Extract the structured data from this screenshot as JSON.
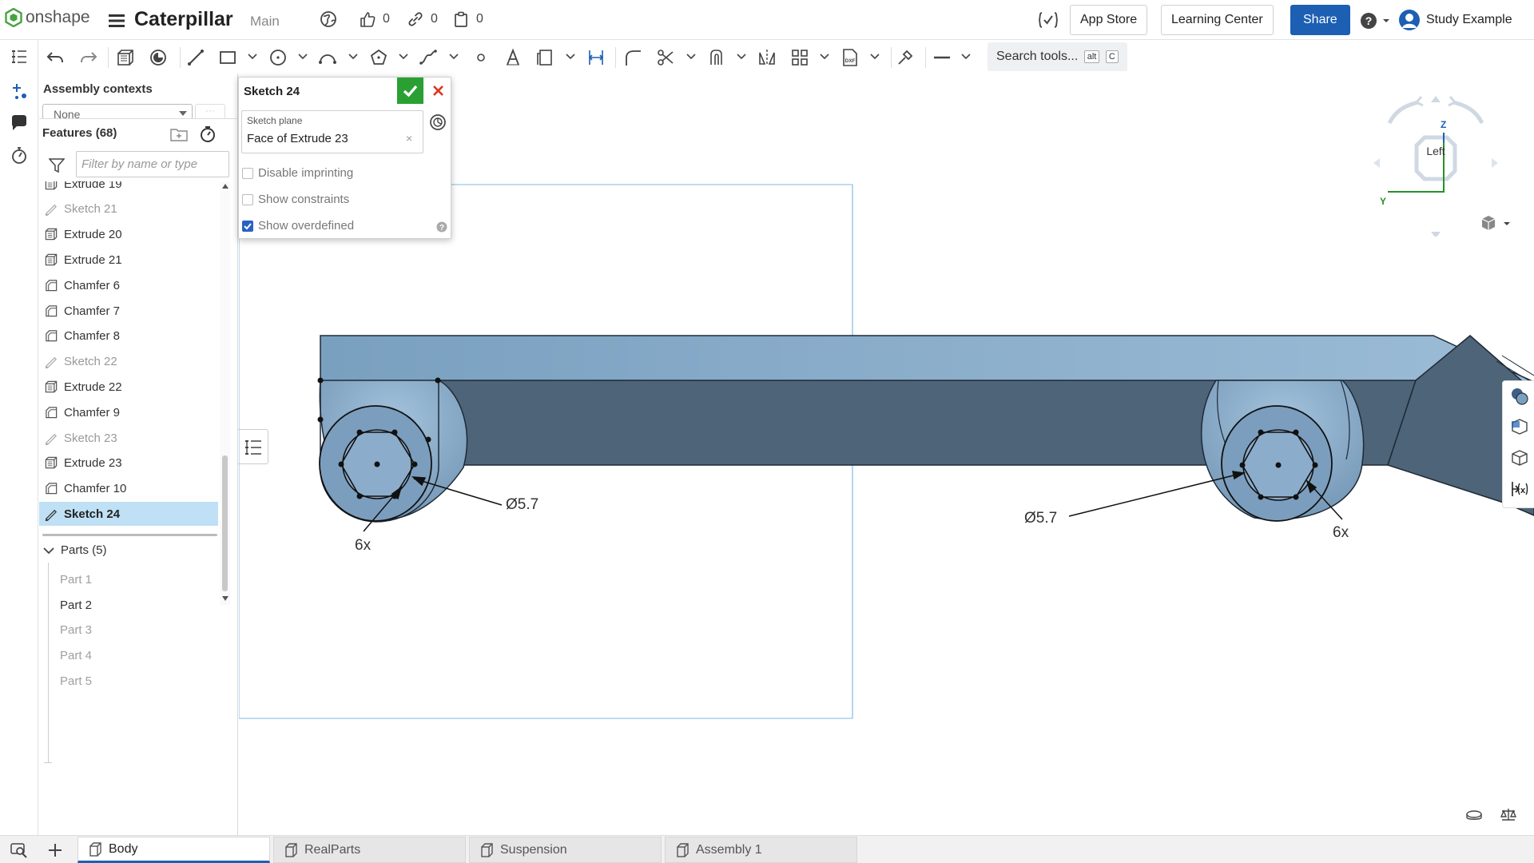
{
  "brand": {
    "name": "onshape"
  },
  "document": {
    "title": "Caterpillar",
    "branch": "Main"
  },
  "header": {
    "likes": "0",
    "links": "0",
    "copies": "0",
    "app_store": "App Store",
    "learning_center": "Learning Center",
    "share": "Share",
    "user": "Study Example"
  },
  "toolbar": {
    "search": "Search tools...",
    "shortcut_alt": "alt",
    "shortcut_key": "C"
  },
  "panel": {
    "assembly_contexts": "Assembly contexts",
    "assembly_context_value": "None",
    "features_title": "Features (68)",
    "filter_placeholder": "Filter by name or type",
    "features": [
      {
        "label": "Extrude 19",
        "type": "extrude"
      },
      {
        "label": "Sketch 21",
        "type": "sketch"
      },
      {
        "label": "Extrude 20",
        "type": "extrude"
      },
      {
        "label": "Extrude 21",
        "type": "extrude"
      },
      {
        "label": "Chamfer 6",
        "type": "chamfer"
      },
      {
        "label": "Chamfer 7",
        "type": "chamfer"
      },
      {
        "label": "Chamfer 8",
        "type": "chamfer"
      },
      {
        "label": "Sketch 22",
        "type": "sketch"
      },
      {
        "label": "Extrude 22",
        "type": "extrude"
      },
      {
        "label": "Chamfer 9",
        "type": "chamfer"
      },
      {
        "label": "Sketch 23",
        "type": "sketch"
      },
      {
        "label": "Extrude 23",
        "type": "extrude"
      },
      {
        "label": "Chamfer 10",
        "type": "chamfer"
      },
      {
        "label": "Sketch 24",
        "type": "sketch",
        "selected": true
      }
    ],
    "parts_title": "Parts (5)",
    "parts": [
      "Part 1",
      "Part 2",
      "Part 3",
      "Part 4",
      "Part 5"
    ]
  },
  "sketch_dialog": {
    "title": "Sketch 24",
    "plane_label": "Sketch plane",
    "plane_value": "Face of Extrude 23",
    "options": [
      {
        "label": "Disable imprinting",
        "checked": false
      },
      {
        "label": "Show constraints",
        "checked": false
      },
      {
        "label": "Show overdefined",
        "checked": true
      }
    ]
  },
  "viewport": {
    "view_cube_face": "Left",
    "axis_z": "Z",
    "axis_y": "Y",
    "dimension_left": "Ø5.7",
    "count_left": "6x",
    "dimension_right": "Ø5.7",
    "count_right": "6x"
  },
  "tabs": [
    {
      "label": "Body",
      "active": true
    },
    {
      "label": "RealParts"
    },
    {
      "label": "Suspension"
    },
    {
      "label": "Assembly 1"
    }
  ],
  "colors": {
    "accent": "#1c5fb3",
    "selection": "#bfe0f5",
    "model_top": "#7ea3c2",
    "model_face": "#4e6478",
    "model_light": "#9bbad4",
    "confirm": "#2aa033",
    "cancel": "#d9341e"
  }
}
